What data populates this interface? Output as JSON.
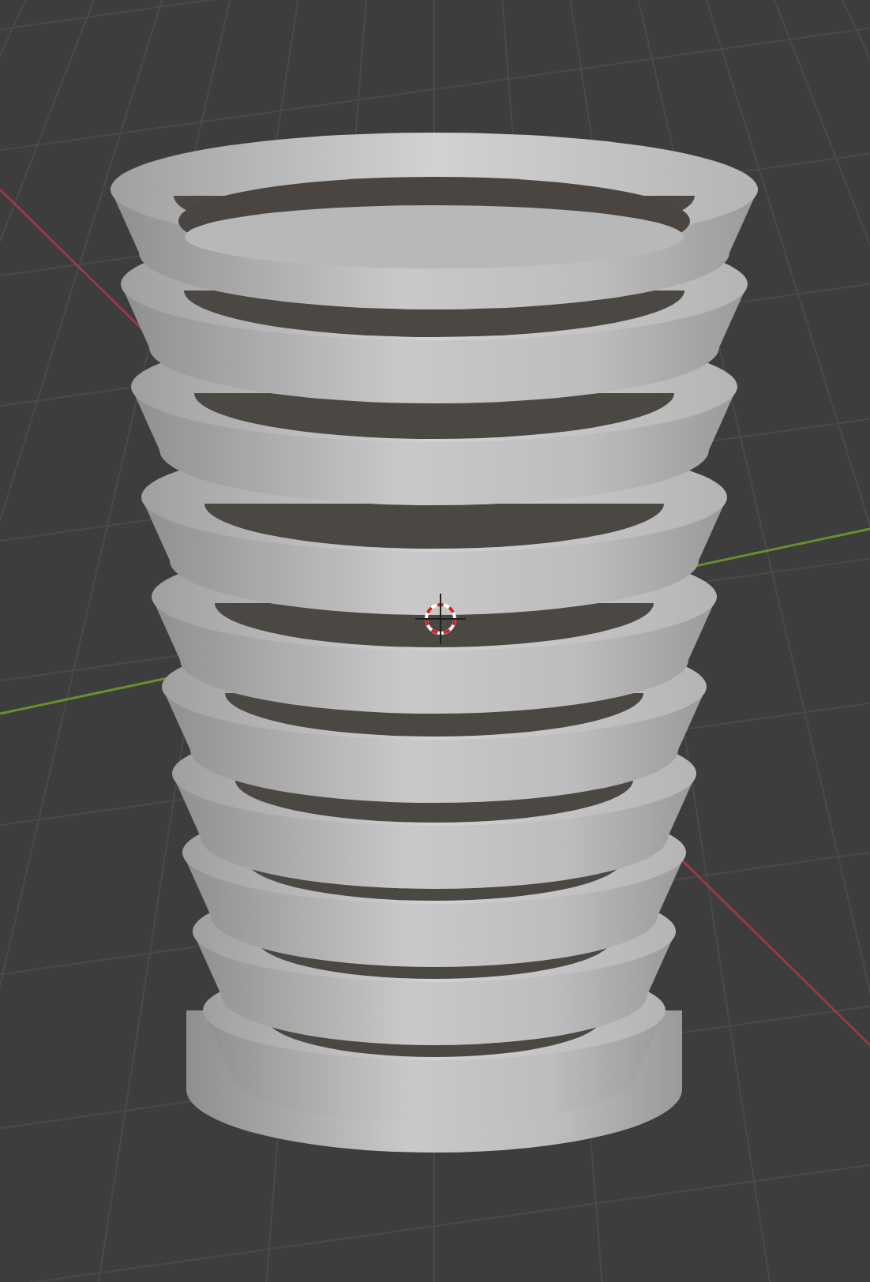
{
  "viewport": {
    "grid": true,
    "axis_lines": true,
    "cursor_3d": true,
    "object": true
  }
}
